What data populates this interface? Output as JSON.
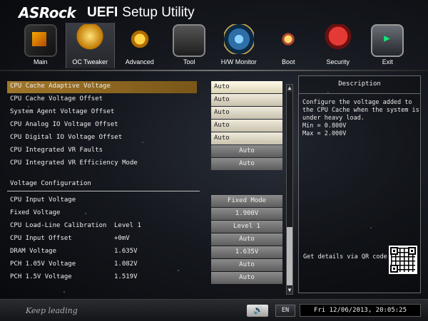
{
  "brand": {
    "logo": "ASRock",
    "title_bold": "UEFI",
    "title_rest": "Setup Utility"
  },
  "tabs": [
    {
      "label": "Main",
      "icon": "main-icon"
    },
    {
      "label": "OC Tweaker",
      "icon": "rocket-icon",
      "active": true
    },
    {
      "label": "Advanced",
      "icon": "star-icon"
    },
    {
      "label": "Tool",
      "icon": "toolbox-icon"
    },
    {
      "label": "H/W Monitor",
      "icon": "radar-icon"
    },
    {
      "label": "Boot",
      "icon": "power-switch-icon"
    },
    {
      "label": "Security",
      "icon": "shield-icon"
    },
    {
      "label": "Exit",
      "icon": "exit-door-icon"
    }
  ],
  "settings": {
    "rows": [
      {
        "label": "CPU Cache Adaptive Voltage",
        "mid": "",
        "value": "Auto"
      },
      {
        "label": "CPU Cache Voltage Offset",
        "mid": "",
        "value": "Auto"
      },
      {
        "label": "System Agent Voltage Offset",
        "mid": "",
        "value": "Auto"
      },
      {
        "label": "CPU Analog IO Voltage Offset",
        "mid": "",
        "value": "Auto"
      },
      {
        "label": "CPU Digital IO Voltage Offset",
        "mid": "",
        "value": "Auto"
      },
      {
        "label": "CPU Integrated VR Faults",
        "mid": "",
        "value": "Auto"
      },
      {
        "label": "CPU Integrated VR Efficiency Mode",
        "mid": "",
        "value": "Auto"
      }
    ],
    "section_title": "Voltage Configuration",
    "rows2": [
      {
        "label": "CPU Input Voltage",
        "mid": "",
        "value": "Fixed Mode"
      },
      {
        "label": " Fixed Voltage",
        "mid": "",
        "value": "1.900V"
      },
      {
        "label": "CPU Load-Line Calibration",
        "mid": "Level 1",
        "value": "Level 1"
      },
      {
        "label": "CPU Input Offset",
        "mid": "+0mV",
        "value": "Auto"
      },
      {
        "label": "DRAM Voltage",
        "mid": "1.635V",
        "value": "1.635V"
      },
      {
        "label": "PCH 1.05V Voltage",
        "mid": "1.082V",
        "value": "Auto"
      },
      {
        "label": "PCH 1.5V Voltage",
        "mid": "1.519V",
        "value": "Auto"
      }
    ]
  },
  "description": {
    "title": "Description",
    "text": "Configure the voltage added to the CPU Cache when the system is under heavy load.\nMin = 0.800V\nMax = 2.000V",
    "qr_label": "Get details via QR code"
  },
  "footer": {
    "tagline": "Keep leading",
    "language": "EN",
    "datetime": "Fri 12/06/2013, 20:05:25"
  }
}
